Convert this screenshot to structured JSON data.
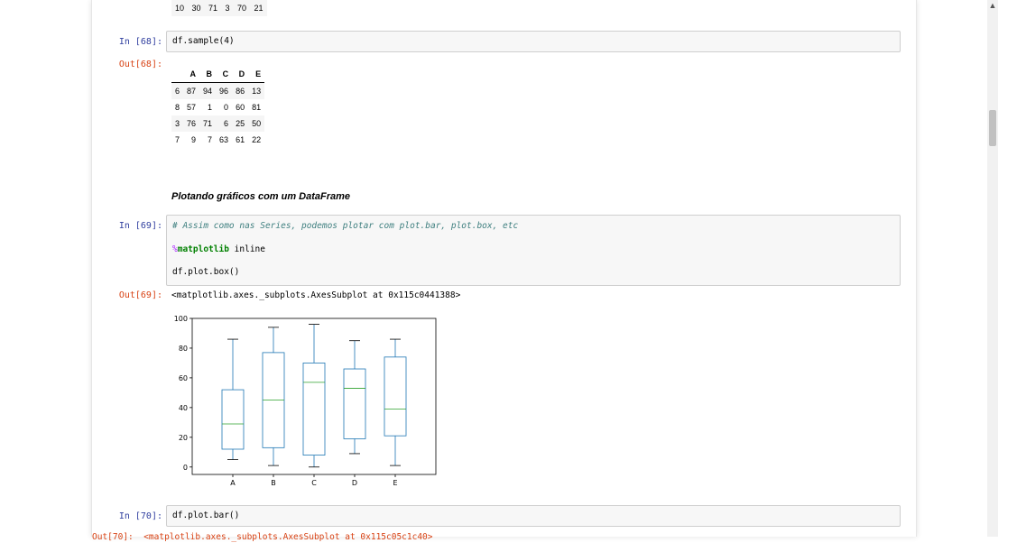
{
  "top_output_row": "10 30 71 3 70 21",
  "cells": {
    "c68": {
      "in_prompt": "In [68]:",
      "code": "df.sample(4)",
      "out_prompt": "Out[68]:"
    },
    "c69": {
      "in_prompt": "In [69]:",
      "comment": "# Assim como nas Series, podemos plotar com plot.bar, plot.box, etc",
      "magic_pct": "%",
      "magic_kw": "matplotlib",
      "magic_arg": " inline",
      "code3": "df.plot.box()",
      "out_prompt": "Out[69]:",
      "out_text": "<matplotlib.axes._subplots.AxesSubplot at 0x115c0441388>"
    },
    "c70": {
      "in_prompt": "In [70]:",
      "code": "df.plot.bar()",
      "out_partial": "Out[70]:  <matplotlib.axes._subplots.AxesSubplot at 0x115c05c1c40>"
    }
  },
  "markdown_heading": "Plotando gráficos com um DataFrame",
  "table": {
    "columns": [
      "A",
      "B",
      "C",
      "D",
      "E"
    ],
    "rows": [
      {
        "index": "6",
        "values": [
          "87",
          "94",
          "96",
          "86",
          "13"
        ]
      },
      {
        "index": "8",
        "values": [
          "57",
          "1",
          "0",
          "60",
          "81"
        ]
      },
      {
        "index": "3",
        "values": [
          "76",
          "71",
          "6",
          "25",
          "50"
        ]
      },
      {
        "index": "7",
        "values": [
          "9",
          "7",
          "63",
          "61",
          "22"
        ]
      }
    ]
  },
  "chart_data": {
    "type": "box",
    "categories": [
      "A",
      "B",
      "C",
      "D",
      "E"
    ],
    "ylim": [
      -5,
      100
    ],
    "yticks": [
      0,
      20,
      40,
      60,
      80,
      100
    ],
    "boxes": [
      {
        "whislo": 5,
        "q1": 12,
        "med": 29,
        "q3": 52,
        "whishi": 86
      },
      {
        "whislo": 1,
        "q1": 13,
        "med": 45,
        "q3": 77,
        "whishi": 94
      },
      {
        "whislo": 0,
        "q1": 8,
        "med": 57,
        "q3": 70,
        "whishi": 96
      },
      {
        "whislo": 9,
        "q1": 19,
        "med": 53,
        "q3": 66,
        "whishi": 85
      },
      {
        "whislo": 1,
        "q1": 21,
        "med": 39,
        "q3": 74,
        "whishi": 86
      }
    ],
    "box_color": "#1f77b4",
    "median_color": "#2ca02c",
    "grid": false
  },
  "colors": {
    "in_prompt": "#303f9f",
    "out_prompt": "#d84315"
  },
  "icons": {
    "scroll_up": "up-arrow-icon"
  }
}
